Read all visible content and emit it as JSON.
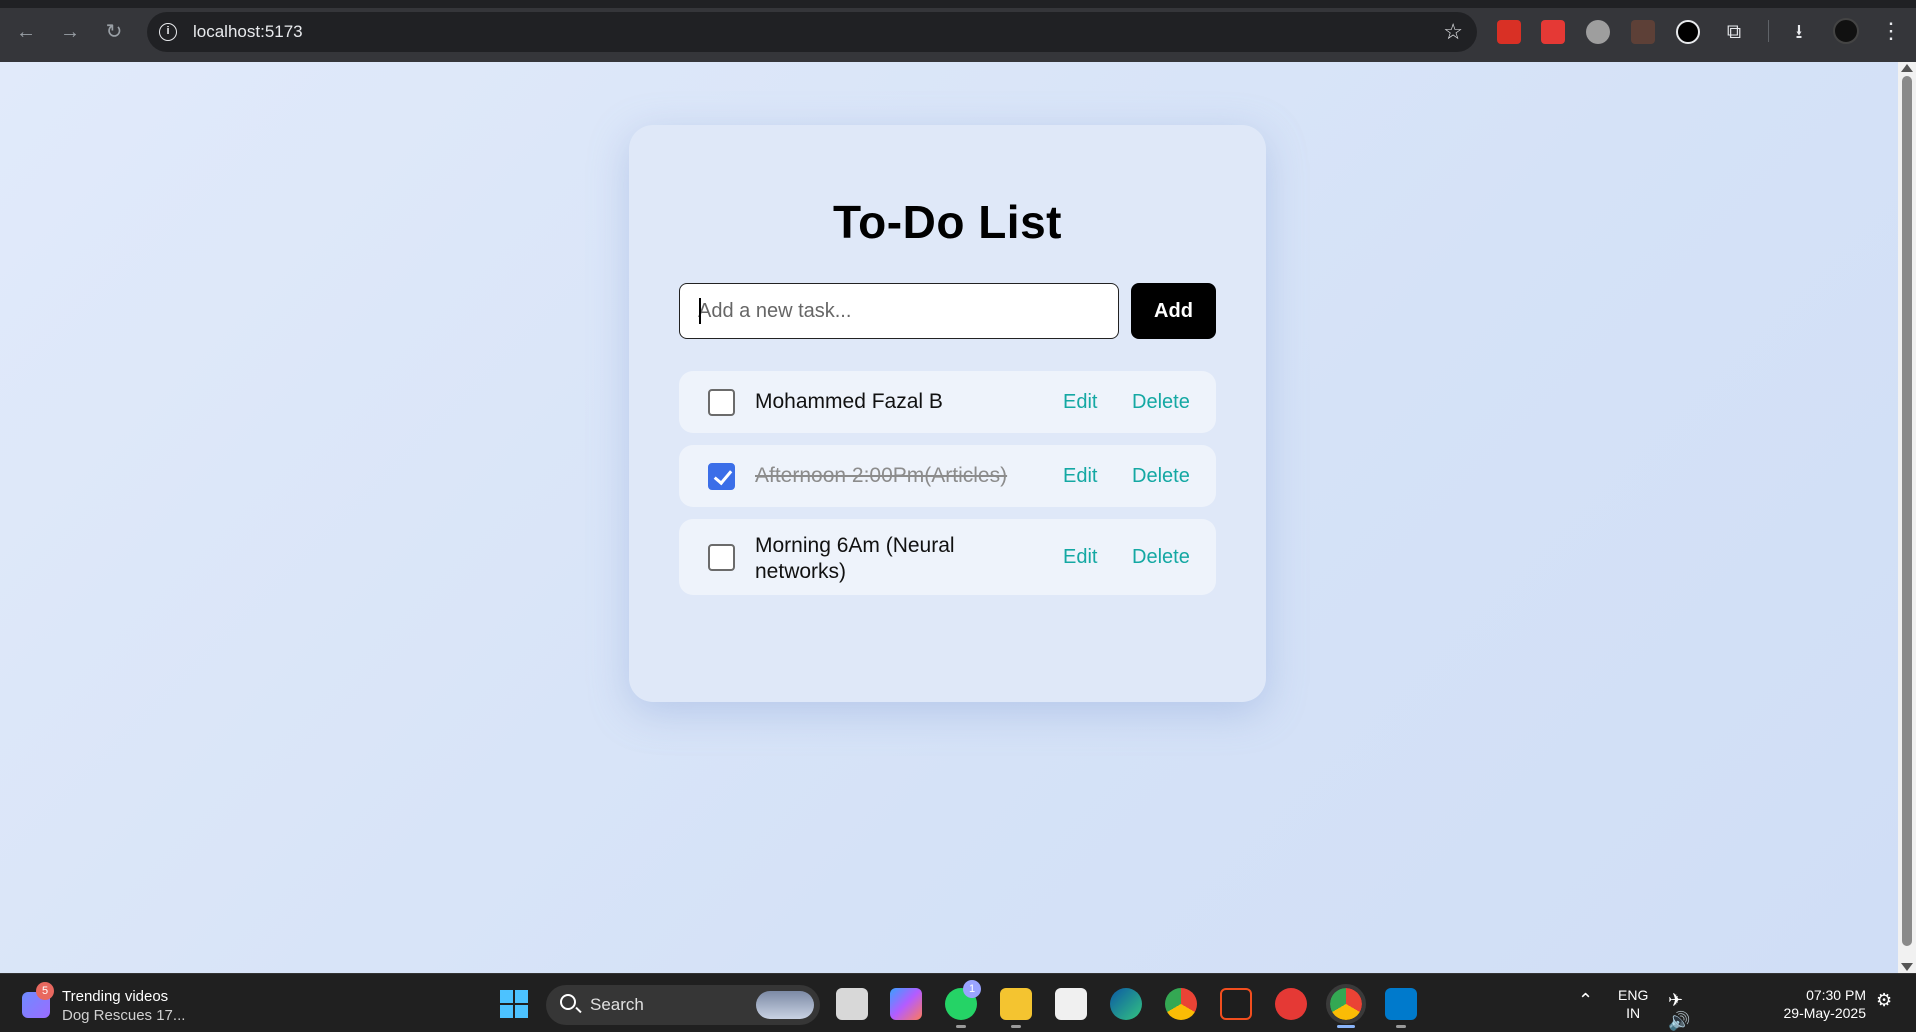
{
  "browser": {
    "url": "localhost:5173",
    "back_icon": "←",
    "forward_icon": "→",
    "reload_icon": "↻",
    "info_icon": "i",
    "star_icon": "☆",
    "extensions_icon": "⧉",
    "download_icon": "⭳",
    "menu_icon": "⋮"
  },
  "app": {
    "title": "To-Do List",
    "input_placeholder": "Add a new task...",
    "add_label": "Add",
    "tasks": [
      {
        "text": "Mohammed Fazal B",
        "done": false,
        "edit_label": "Edit",
        "delete_label": "Delete"
      },
      {
        "text": "Afternoon 2:00Pm(Articles)",
        "done": true,
        "edit_label": "Edit",
        "delete_label": "Delete"
      },
      {
        "text": "Morning 6Am (Neural networks)",
        "done": false,
        "edit_label": "Edit",
        "delete_label": "Delete"
      }
    ]
  },
  "taskbar": {
    "news_title": "Trending videos",
    "news_subtitle": "Dog Rescues 17...",
    "news_badge": "5",
    "search_label": "Search",
    "whatsapp_badge": "1",
    "language_line1": "ENG",
    "language_line2": "IN",
    "time": "07:30 PM",
    "date": "29-May-2025"
  },
  "colors": {
    "accent_link": "#14a8a3",
    "checkbox_checked": "#3b6ee8",
    "add_button": "#000000"
  }
}
